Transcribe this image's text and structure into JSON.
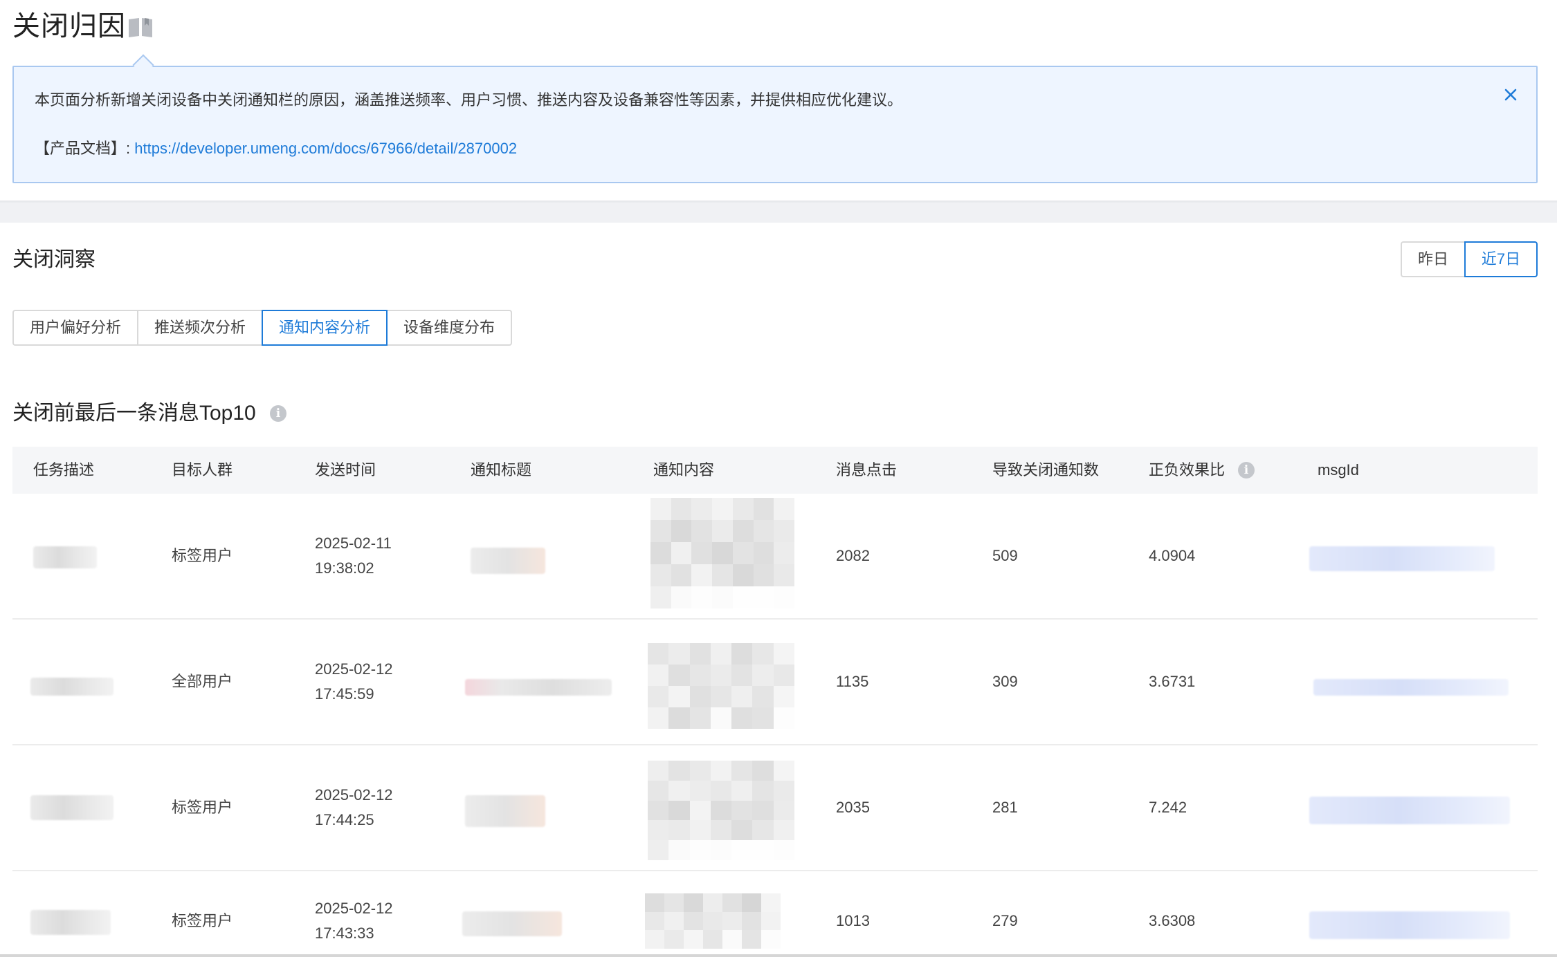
{
  "header": {
    "title": "关闭归因",
    "book_icon": "book-icon"
  },
  "notice": {
    "text": "本页面分析新增关闭设备中关闭通知栏的原因，涵盖推送频率、用户习惯、推送内容及设备兼容性等因素，并提供相应优化建议。",
    "doc_label": "【产品文档】:",
    "doc_link": "https://developer.umeng.com/docs/67966/detail/2870002",
    "close_icon": "close-icon"
  },
  "insight": {
    "title": "关闭洞察",
    "range": {
      "options": [
        "昨日",
        "近7日"
      ],
      "selected": "近7日"
    },
    "tabs": [
      "用户偏好分析",
      "推送频次分析",
      "通知内容分析",
      "设备维度分布"
    ],
    "active_tab": "通知内容分析"
  },
  "top_table": {
    "title": "关闭前最后一条消息Top10",
    "columns": [
      "任务描述",
      "目标人群",
      "发送时间",
      "通知标题",
      "通知内容",
      "消息点击",
      "导致关闭通知数",
      "正负效果比",
      "msgId"
    ],
    "rows": [
      {
        "audience": "标签用户",
        "date": "2025-02-11",
        "time": "19:38:02",
        "clicks": "2082",
        "closes": "509",
        "ratio": "4.0904"
      },
      {
        "audience": "全部用户",
        "date": "2025-02-12",
        "time": "17:45:59",
        "clicks": "1135",
        "closes": "309",
        "ratio": "3.6731"
      },
      {
        "audience": "标签用户",
        "date": "2025-02-12",
        "time": "17:44:25",
        "clicks": "2035",
        "closes": "281",
        "ratio": "7.242"
      },
      {
        "audience": "标签用户",
        "date": "2025-02-12",
        "time": "17:43:33",
        "clicks": "1013",
        "closes": "279",
        "ratio": "3.6308"
      }
    ]
  },
  "colors": {
    "accent": "#1e7bd8",
    "notice_bg": "#eef5ff",
    "notice_border": "#a9c8f0",
    "header_row_bg": "#f5f6f8"
  }
}
